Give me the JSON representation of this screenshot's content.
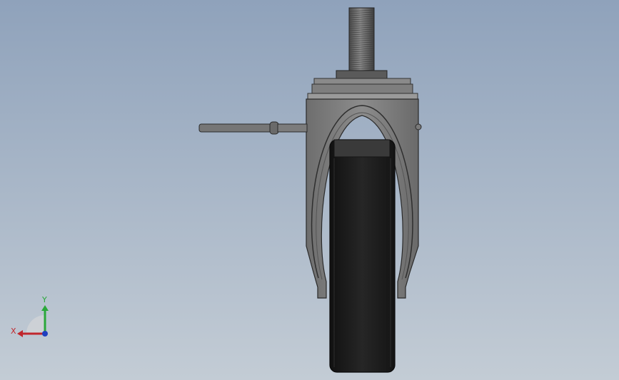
{
  "model": {
    "name": "caster-wheel-front-view"
  },
  "triad": {
    "x_label": "X",
    "y_label": "Y",
    "x_color": "#c0272d",
    "y_color": "#2aa83a",
    "z_color": "#1f3fbf"
  },
  "colors": {
    "background_top": "#8fa2bb",
    "background_bottom": "#c3ccd5",
    "metal": "#7d7d7d",
    "metal_dark": "#4a4a4a",
    "tire": "#1e1e1e"
  }
}
